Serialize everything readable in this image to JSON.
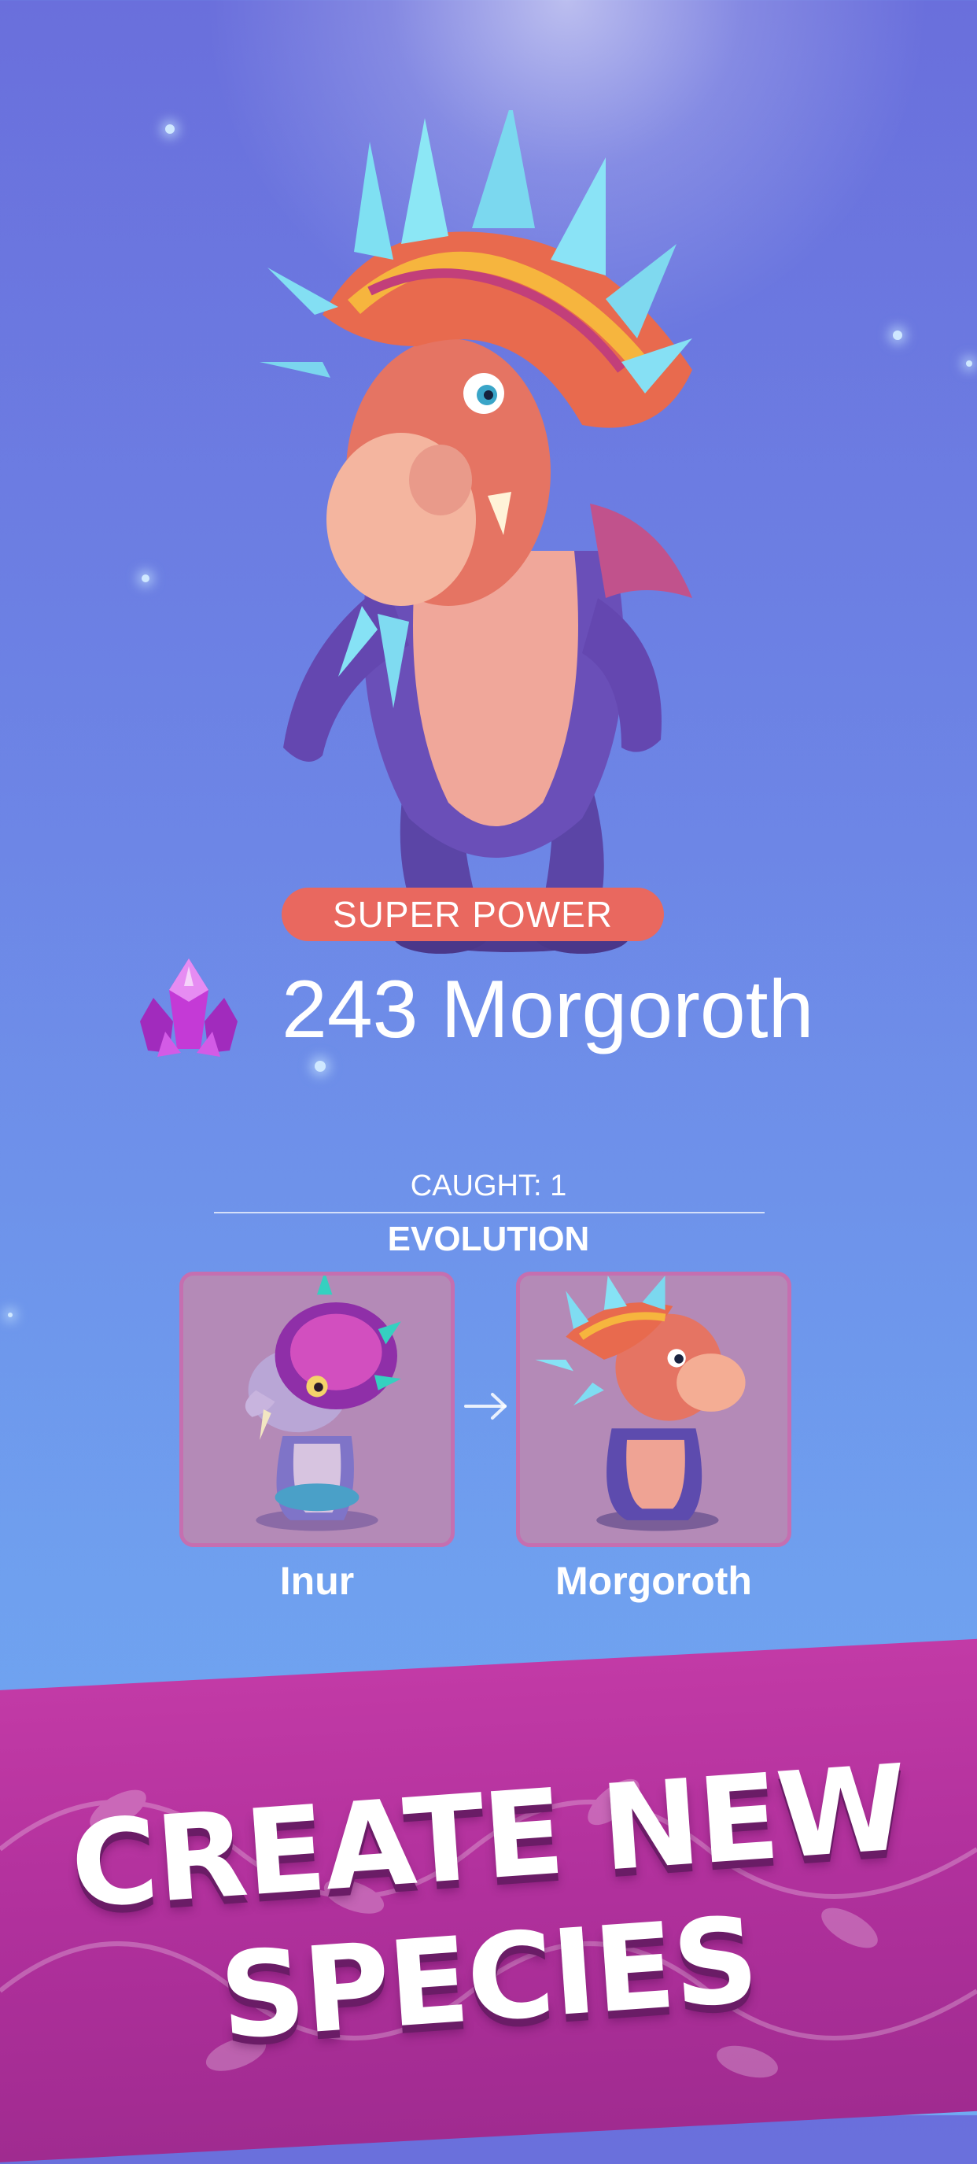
{
  "badge": {
    "label": "SUPER POWER"
  },
  "creature": {
    "count": 243,
    "name": "243 Morgoroth"
  },
  "stats": {
    "caught": "CAUGHT: 1"
  },
  "evolution": {
    "title": "EVOLUTION",
    "stages": [
      {
        "name": "Inur"
      },
      {
        "name": "Morgoroth"
      }
    ]
  },
  "banner": {
    "line1": "CREATE NEW",
    "line2": "SPECIES"
  },
  "colors": {
    "badge": "#e9685f",
    "banner": "#b0309c",
    "card": "#b48ab7",
    "crystal": "#c43ad6"
  },
  "icons": [
    "crystal-icon",
    "arrow-right-icon"
  ]
}
